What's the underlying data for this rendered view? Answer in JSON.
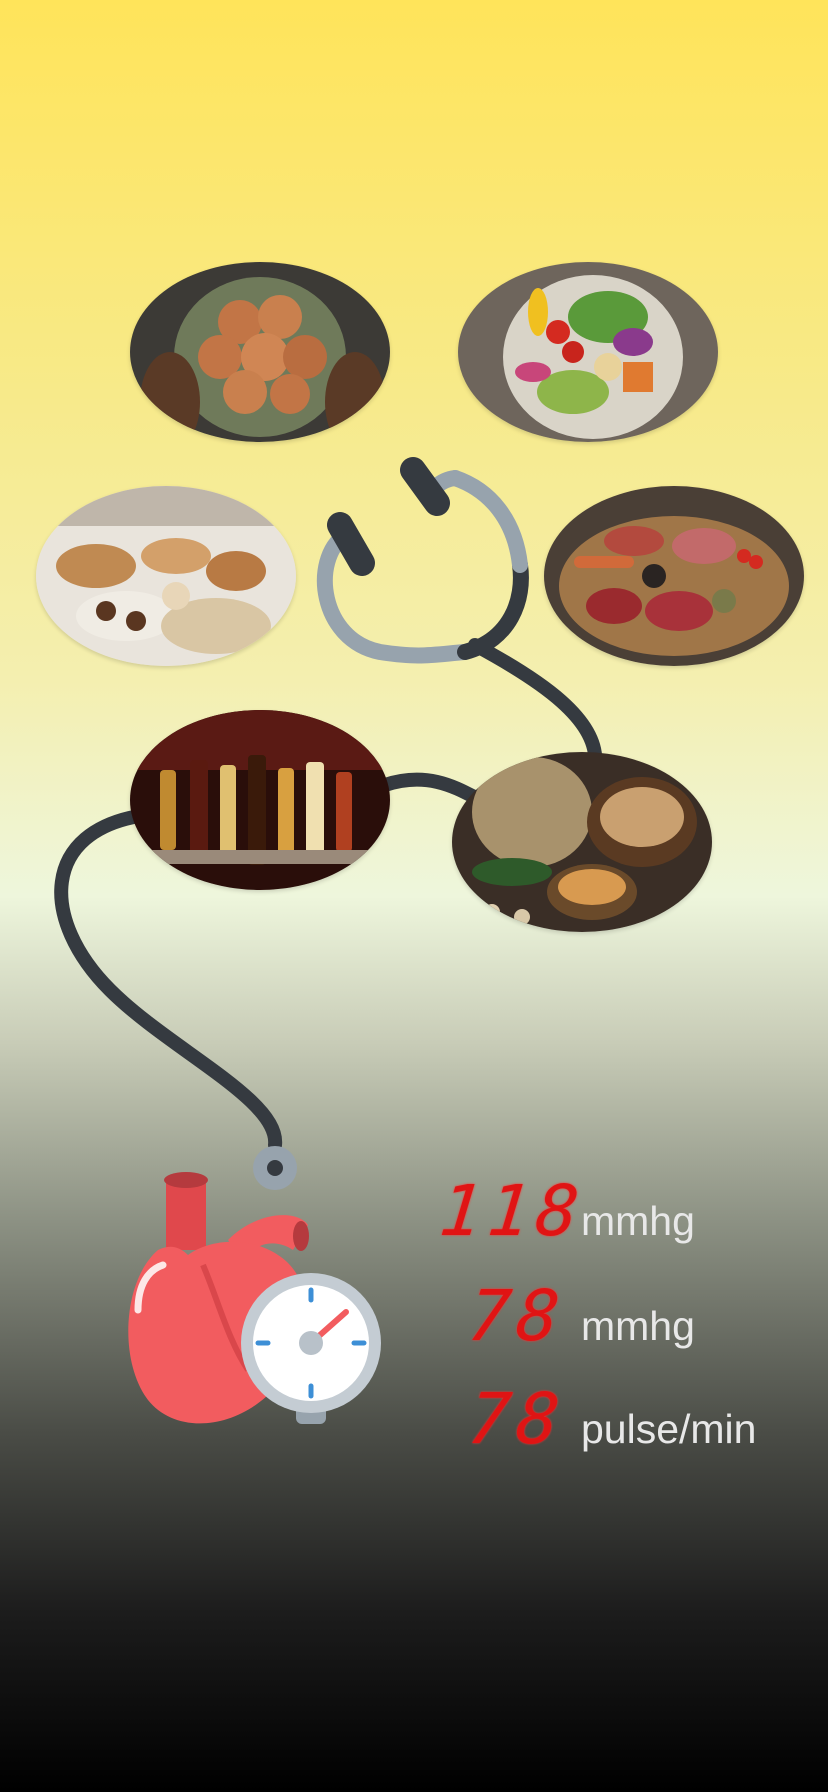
{
  "photos": [
    {
      "name": "eggs-bowl-photo",
      "label": "eggs in a bowl"
    },
    {
      "name": "vegetable-salad-photo",
      "label": "vegetable salad bowl"
    },
    {
      "name": "pastries-photo",
      "label": "pastries and baked goods"
    },
    {
      "name": "raw-meat-photo",
      "label": "raw meat board"
    },
    {
      "name": "liquor-bottles-photo",
      "label": "liquor bottles"
    },
    {
      "name": "nuts-photo",
      "label": "nuts in sacks"
    }
  ],
  "readings": {
    "systolic": {
      "value": "118",
      "unit": "mmhg"
    },
    "diastolic": {
      "value": "78",
      "unit": "mmhg"
    },
    "pulse": {
      "value": "78",
      "unit": "pulse/min"
    }
  },
  "colors": {
    "digit_red": "#e01414",
    "tube_dark": "#353a40",
    "tube_light": "#97a3ad",
    "heart_red": "#f25c5f",
    "gauge_blue": "#3d8fd6"
  },
  "icons": [
    "stethoscope-icon",
    "heart-icon",
    "gauge-icon"
  ]
}
